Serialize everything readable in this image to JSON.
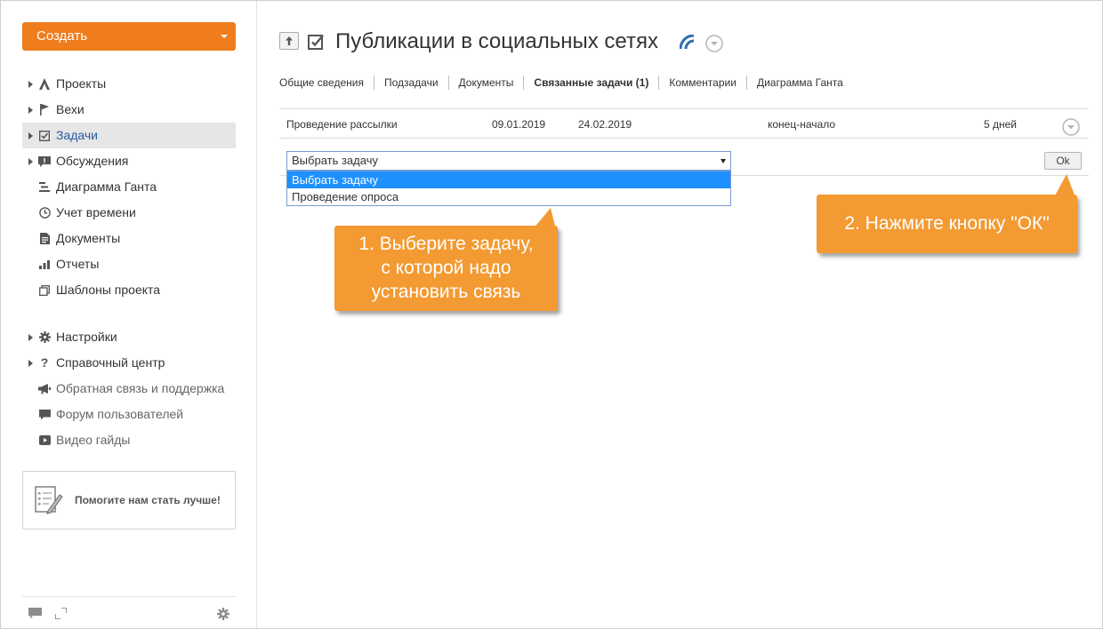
{
  "sidebar": {
    "create_label": "Создать",
    "nav": [
      {
        "label": "Проекты",
        "icon": "projects-icon"
      },
      {
        "label": "Вехи",
        "icon": "milestone-flag-icon"
      },
      {
        "label": "Задачи",
        "icon": "tasks-checkbox-icon",
        "active": true
      },
      {
        "label": "Обсуждения",
        "icon": "discussions-icon"
      },
      {
        "label": "Диаграмма Ганта",
        "icon": "gantt-icon"
      },
      {
        "label": "Учет времени",
        "icon": "clock-icon"
      },
      {
        "label": "Документы",
        "icon": "documents-icon"
      },
      {
        "label": "Отчеты",
        "icon": "reports-icon"
      },
      {
        "label": "Шаблоны проекта",
        "icon": "templates-icon"
      }
    ],
    "nav2": [
      {
        "label": "Настройки",
        "icon": "gear-icon"
      },
      {
        "label": "Справочный центр",
        "icon": "question-icon"
      },
      {
        "label": "Обратная связь и поддержка",
        "icon": "megaphone-icon"
      },
      {
        "label": "Форум пользователей",
        "icon": "forum-icon"
      },
      {
        "label": "Видео гайды",
        "icon": "video-icon"
      }
    ],
    "help_box": "Помогите нам стать лучше!"
  },
  "header": {
    "title": "Публикации в социальных сетях"
  },
  "tabs": [
    {
      "label": "Общие сведения"
    },
    {
      "label": "Подзадачи"
    },
    {
      "label": "Документы"
    },
    {
      "label": "Связанные задачи (1)",
      "active": true
    },
    {
      "label": "Комментарии"
    },
    {
      "label": "Диаграмма Ганта"
    }
  ],
  "related": {
    "name": "Проведение рассылки",
    "start": "09.01.2019",
    "end": "24.02.2019",
    "link_type": "конец-начало",
    "duration": "5 дней"
  },
  "select": {
    "value": "Выбрать задачу",
    "options": [
      "Выбрать задачу",
      "Проведение опроса"
    ]
  },
  "ok_label": "Ok",
  "callouts": {
    "step1": [
      "1. Выберите задачу,",
      "с которой надо",
      "установить связь"
    ],
    "step2": "2. Нажмите кнопку \"ОК\""
  },
  "colors": {
    "accent": "#ef7d1d",
    "callout": "#f39a32",
    "active_link": "#2a5aa3",
    "selection": "#1e90ff"
  }
}
